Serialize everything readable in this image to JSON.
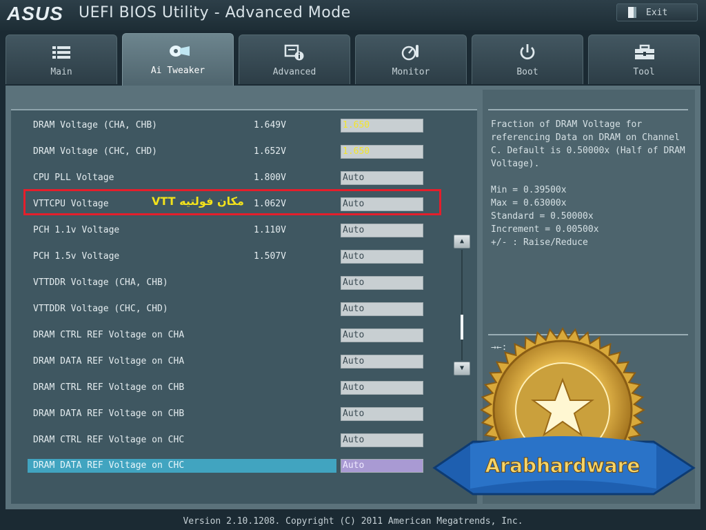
{
  "header": {
    "brand": "ASUS",
    "title": "UEFI BIOS Utility - Advanced Mode",
    "exit_label": "Exit"
  },
  "tabs": [
    {
      "label": "Main",
      "icon": "list-icon",
      "active": false
    },
    {
      "label": "Ai Tweaker",
      "icon": "rocket-icon",
      "active": true
    },
    {
      "label": "Advanced",
      "icon": "settings-info-icon",
      "active": false
    },
    {
      "label": "Monitor",
      "icon": "monitor-gauge-icon",
      "active": false
    },
    {
      "label": "Boot",
      "icon": "power-icon",
      "active": false
    },
    {
      "label": "Tool",
      "icon": "toolbox-icon",
      "active": false
    }
  ],
  "settings": [
    {
      "label": "DRAM Voltage (CHA, CHB)",
      "current": "1.649V",
      "value": "1.650",
      "manual": true
    },
    {
      "label": "DRAM Voltage (CHC, CHD)",
      "current": "1.652V",
      "value": "1.650",
      "manual": true
    },
    {
      "label": "CPU PLL Voltage",
      "current": "1.800V",
      "value": "Auto"
    },
    {
      "label": "VTTCPU Voltage",
      "current": "1.062V",
      "value": "Auto"
    },
    {
      "label": "PCH 1.1v Voltage",
      "current": "1.110V",
      "value": "Auto"
    },
    {
      "label": "PCH 1.5v Voltage",
      "current": "1.507V",
      "value": "Auto"
    },
    {
      "label": "VTTDDR Voltage (CHA, CHB)",
      "current": "",
      "value": "Auto"
    },
    {
      "label": "VTTDDR Voltage (CHC, CHD)",
      "current": "",
      "value": "Auto"
    },
    {
      "label": "DRAM CTRL REF Voltage on CHA",
      "current": "",
      "value": "Auto"
    },
    {
      "label": "DRAM DATA REF Voltage on CHA",
      "current": "",
      "value": "Auto"
    },
    {
      "label": "DRAM CTRL REF Voltage on CHB",
      "current": "",
      "value": "Auto"
    },
    {
      "label": "DRAM DATA REF Voltage on CHB",
      "current": "",
      "value": "Auto"
    },
    {
      "label": "DRAM CTRL REF Voltage on CHC",
      "current": "",
      "value": "Auto"
    },
    {
      "label": "DRAM DATA REF Voltage on CHC",
      "current": "",
      "value": "Auto",
      "selected": true
    }
  ],
  "annotation": {
    "text": "مكان فولتيه VTT",
    "color": "#e51e2b"
  },
  "scroll": {
    "up_glyph": "▲",
    "down_glyph": "▼"
  },
  "help": {
    "lines": [
      "Fraction of DRAM Voltage for",
      "referencing Data on DRAM on Channel",
      "C. Default is 0.50000x (Half of DRAM",
      "Voltage).",
      "",
      "Min = 0.39500x",
      "Max = 0.63000x",
      "Standard = 0.50000x",
      "Increment = 0.00500x",
      "+/- : Raise/Reduce"
    ],
    "keys": "→←:"
  },
  "watermark": {
    "text": "Arabhardware"
  },
  "footer": {
    "text": "Version 2.10.1208. Copyright (C) 2011 American Megatrends, Inc."
  },
  "colors": {
    "accent_selected": "#41a4c0",
    "manual_value": "#f3e52a",
    "annotation_red": "#e51e2b"
  }
}
